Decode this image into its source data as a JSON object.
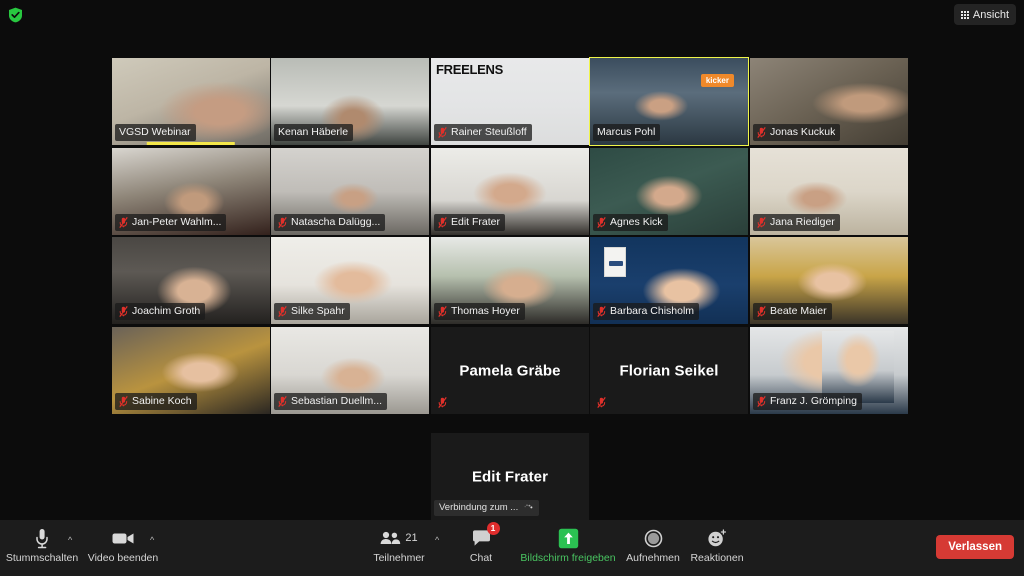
{
  "topbar": {
    "encryption_icon": "shield-check-icon",
    "view_button": {
      "label": "Ansicht",
      "icon": "grid-view-icon"
    }
  },
  "grid": {
    "active_speaker": "Marcus Pohl",
    "participants": [
      {
        "name": "VGSD Webinar",
        "muted": false,
        "row": 0,
        "col": 0,
        "style": "p1",
        "speaking_bar": true
      },
      {
        "name": "Kenan Häberle",
        "muted": false,
        "row": 0,
        "col": 1,
        "style": "p2"
      },
      {
        "name": "Rainer Steußloff",
        "muted": true,
        "row": 0,
        "col": 2,
        "style": "p3",
        "overlay_logo": "FREELENS"
      },
      {
        "name": "Marcus Pohl",
        "muted": false,
        "row": 0,
        "col": 3,
        "style": "p4",
        "active": true,
        "overlay_badge": "kicker"
      },
      {
        "name": "Jonas Kuckuk",
        "muted": true,
        "row": 0,
        "col": 4,
        "style": "p5"
      },
      {
        "name": "Jan-Peter Wahlm...",
        "muted": true,
        "row": 1,
        "col": 0,
        "style": "p6"
      },
      {
        "name": "Natascha Dalügg...",
        "muted": true,
        "row": 1,
        "col": 1,
        "style": "p7"
      },
      {
        "name": "Edit Frater",
        "muted": true,
        "row": 1,
        "col": 2,
        "style": "p8"
      },
      {
        "name": "Agnes Kick",
        "muted": true,
        "row": 1,
        "col": 3,
        "style": "p9"
      },
      {
        "name": "Jana Riediger",
        "muted": true,
        "row": 1,
        "col": 4,
        "style": "p10"
      },
      {
        "name": "Joachim Groth",
        "muted": true,
        "row": 2,
        "col": 0,
        "style": "p11"
      },
      {
        "name": "Silke Spahr",
        "muted": true,
        "row": 2,
        "col": 1,
        "style": "p12"
      },
      {
        "name": "Thomas Hoyer",
        "muted": true,
        "row": 2,
        "col": 2,
        "style": "p13"
      },
      {
        "name": "Barbara Chisholm",
        "muted": true,
        "row": 2,
        "col": 3,
        "style": "p14",
        "mini_card": true
      },
      {
        "name": "Beate Maier",
        "muted": true,
        "row": 2,
        "col": 4,
        "style": "p15"
      },
      {
        "name": "Sabine Koch",
        "muted": true,
        "row": 3,
        "col": 0,
        "style": "p16"
      },
      {
        "name": "Sebastian Duellm...",
        "muted": true,
        "row": 3,
        "col": 1,
        "style": "p17"
      },
      {
        "name": "Pamela Gräbe",
        "muted": true,
        "row": 3,
        "col": 2,
        "video_off": true
      },
      {
        "name": "Florian Seikel",
        "muted": true,
        "row": 3,
        "col": 3,
        "video_off": true
      },
      {
        "name": "Franz J. Grömping",
        "muted": true,
        "row": 3,
        "col": 4,
        "avatar_photo": true,
        "style": "p19"
      },
      {
        "name": "Edit Frater",
        "row": 4,
        "col": 2,
        "video_off": true,
        "connecting": true,
        "status": "Verbindung zum ..."
      }
    ]
  },
  "toolbar": {
    "mute": {
      "label": "Stummschalten",
      "icon": "microphone-icon"
    },
    "video": {
      "label": "Video beenden",
      "icon": "video-camera-icon"
    },
    "participants": {
      "label": "Teilnehmer",
      "icon": "people-icon",
      "count": "21"
    },
    "chat": {
      "label": "Chat",
      "icon": "chat-bubble-icon",
      "badge": "1"
    },
    "share": {
      "label": "Bildschirm freigeben",
      "icon": "share-screen-icon",
      "color": "#49c461"
    },
    "record": {
      "label": "Aufnehmen",
      "icon": "record-circle-icon"
    },
    "reactions": {
      "label": "Reaktionen",
      "icon": "smiley-plus-icon"
    },
    "leave": {
      "label": "Verlassen",
      "color": "#d63a34"
    }
  }
}
